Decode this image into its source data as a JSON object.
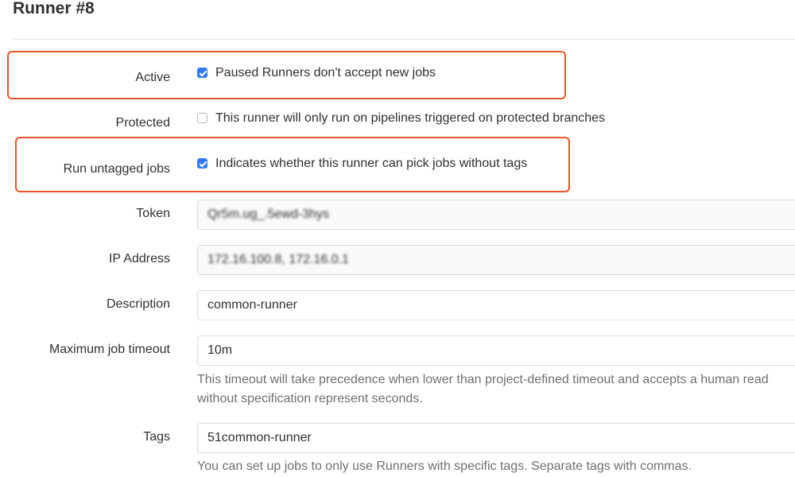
{
  "page": {
    "title": "Runner #8"
  },
  "form": {
    "active": {
      "label": "Active",
      "checked": true,
      "text": "Paused Runners don't accept new jobs"
    },
    "protected": {
      "label": "Protected",
      "checked": false,
      "text": "This runner will only run on pipelines triggered on protected branches"
    },
    "run_untagged": {
      "label": "Run untagged jobs",
      "checked": true,
      "text": "Indicates whether this runner can pick jobs without tags"
    },
    "token": {
      "label": "Token",
      "value": "Qr5m.ug_.5ewd-3hys"
    },
    "ip_address": {
      "label": "IP Address",
      "value": "172.16.100.8, 172.16.0.1"
    },
    "description": {
      "label": "Description",
      "value": "common-runner"
    },
    "max_timeout": {
      "label": "Maximum job timeout",
      "value": "10m",
      "help_line1": "This timeout will take precedence when lower than project-defined timeout and accepts a human read",
      "help_line2": "without specification represent seconds."
    },
    "tags": {
      "label": "Tags",
      "value": "51common-runner",
      "help": "You can set up jobs to only use Runners with specific tags. Separate tags with commas."
    }
  },
  "colors": {
    "checkbox_checked": "#2f7cf6",
    "highlight_annotation": "#e8562a",
    "help_text": "#707070"
  }
}
